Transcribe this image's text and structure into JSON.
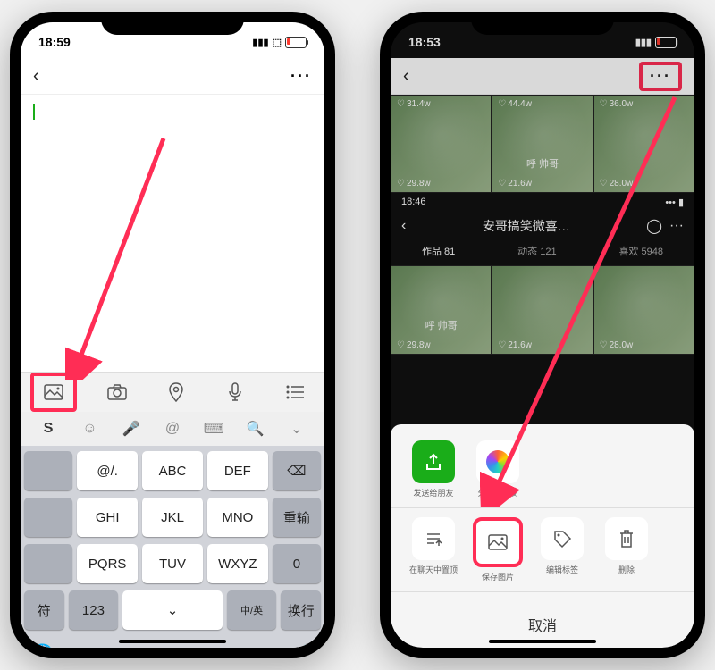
{
  "phone1": {
    "time": "18:59",
    "nav": {
      "back": "‹",
      "more": "···"
    },
    "toolbar": {
      "image": "image",
      "camera": "camera",
      "location": "location",
      "voice": "voice",
      "list": "list"
    },
    "suggest": [
      "S",
      "☺",
      "🎤",
      "@",
      "⌨",
      "🔍",
      "⌄"
    ],
    "keys": {
      "r1": [
        "@/.",
        "ABC",
        "DEF"
      ],
      "r2": [
        "GHI",
        "JKL",
        "MNO"
      ],
      "r3": [
        "PQRS",
        "TUV",
        "WXYZ"
      ],
      "side1": "⌫",
      "side2": "重输",
      "side3": "0",
      "side4": "换行",
      "bot": [
        "符",
        "123",
        "⌄",
        "中/英"
      ]
    }
  },
  "phone2": {
    "time": "18:53",
    "nav": {
      "back": "‹",
      "more": "···"
    },
    "thumbs_top": [
      {
        "top": "31.4w",
        "bot": "29.8w",
        "cap": ""
      },
      {
        "top": "44.4w",
        "bot": "21.6w",
        "cap": "呼 帅哥"
      },
      {
        "top": "36.0w",
        "bot": "28.0w",
        "cap": ""
      }
    ],
    "mid": {
      "time": "18:46",
      "title": "安哥搞笑微喜…",
      "tabs": [
        "作品 81",
        "动态 121",
        "喜欢 5948"
      ]
    },
    "thumbs_bot": [
      {
        "bot": "29.8w",
        "cap": "呼 帅哥"
      },
      {
        "bot": "21.6w",
        "cap": ""
      },
      {
        "bot": "28.0w",
        "cap": ""
      }
    ],
    "sheet": {
      "row1": [
        {
          "label": "发送给朋友"
        },
        {
          "label": "分享到朋友"
        }
      ],
      "row2": [
        {
          "label": "在聊天中置顶"
        },
        {
          "label": "保存图片"
        },
        {
          "label": "编辑标签"
        },
        {
          "label": "删除"
        }
      ],
      "cancel": "取消"
    }
  }
}
